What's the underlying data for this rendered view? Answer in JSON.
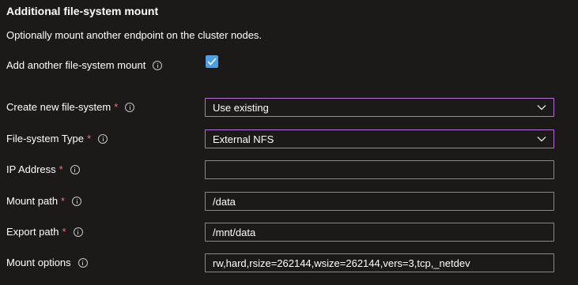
{
  "section": {
    "heading": "Additional file-system mount",
    "description": "Optionally mount another endpoint on the cluster nodes."
  },
  "add_mount": {
    "label": "Add another file-system mount",
    "checked": true
  },
  "fields": {
    "create_fs": {
      "label": "Create new file-system",
      "required_mark": "*",
      "value": "Use existing"
    },
    "fs_type": {
      "label": "File-system Type",
      "required_mark": "*",
      "value": "External NFS"
    },
    "ip_address": {
      "label": "IP Address",
      "required_mark": "*",
      "value": ""
    },
    "mount_path": {
      "label": "Mount path",
      "required_mark": "*",
      "value": "/data"
    },
    "export_path": {
      "label": "Export path",
      "required_mark": "*",
      "value": "/mnt/data"
    },
    "mount_options": {
      "label": "Mount options",
      "value": "rw,hard,rsize=262144,wsize=262144,vers=3,tcp,_netdev"
    }
  },
  "icons": {
    "info": "info-icon",
    "chevron": "chevron-down-icon",
    "check": "checkmark-icon"
  },
  "colors": {
    "background": "#1b1a19",
    "checkbox": "#4b9fe6",
    "select_border": "#b86fd6",
    "input_border": "#8a8886",
    "required": "#f1707b"
  }
}
